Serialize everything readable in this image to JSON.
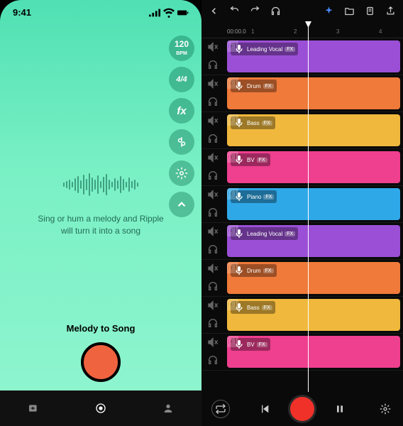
{
  "phone": {
    "status_time": "9:41",
    "side_buttons": [
      {
        "label": "120",
        "sub": "BPM",
        "icon": null
      },
      {
        "label": "4/4",
        "icon": null
      },
      {
        "label": "fx",
        "icon": null
      },
      {
        "label": null,
        "icon": "tune"
      },
      {
        "label": null,
        "icon": "gear"
      },
      {
        "label": null,
        "icon": "chevron-up"
      }
    ],
    "hint_line1": "Sing or hum a melody and Ripple",
    "hint_line2": "will turn it into a song",
    "melody_label": "Melody to Song"
  },
  "daw": {
    "ruler_start": "00:00.0",
    "ruler_marks": [
      "1",
      "2",
      "3",
      "4"
    ],
    "tracks": [
      {
        "name": "Leading Vocal",
        "color": "#9b4fd6"
      },
      {
        "name": "Drum",
        "color": "#f07a3a"
      },
      {
        "name": "Bass",
        "color": "#f0b83c"
      },
      {
        "name": "BV",
        "color": "#ef3f8f"
      },
      {
        "name": "Piano",
        "color": "#2fa8e8"
      },
      {
        "name": "Leading Vocal",
        "color": "#9b4fd6"
      },
      {
        "name": "Drum",
        "color": "#f07a3a"
      },
      {
        "name": "Bass",
        "color": "#f0b83c"
      },
      {
        "name": "BV",
        "color": "#ef3f8f"
      }
    ],
    "fx_label": "FX"
  }
}
